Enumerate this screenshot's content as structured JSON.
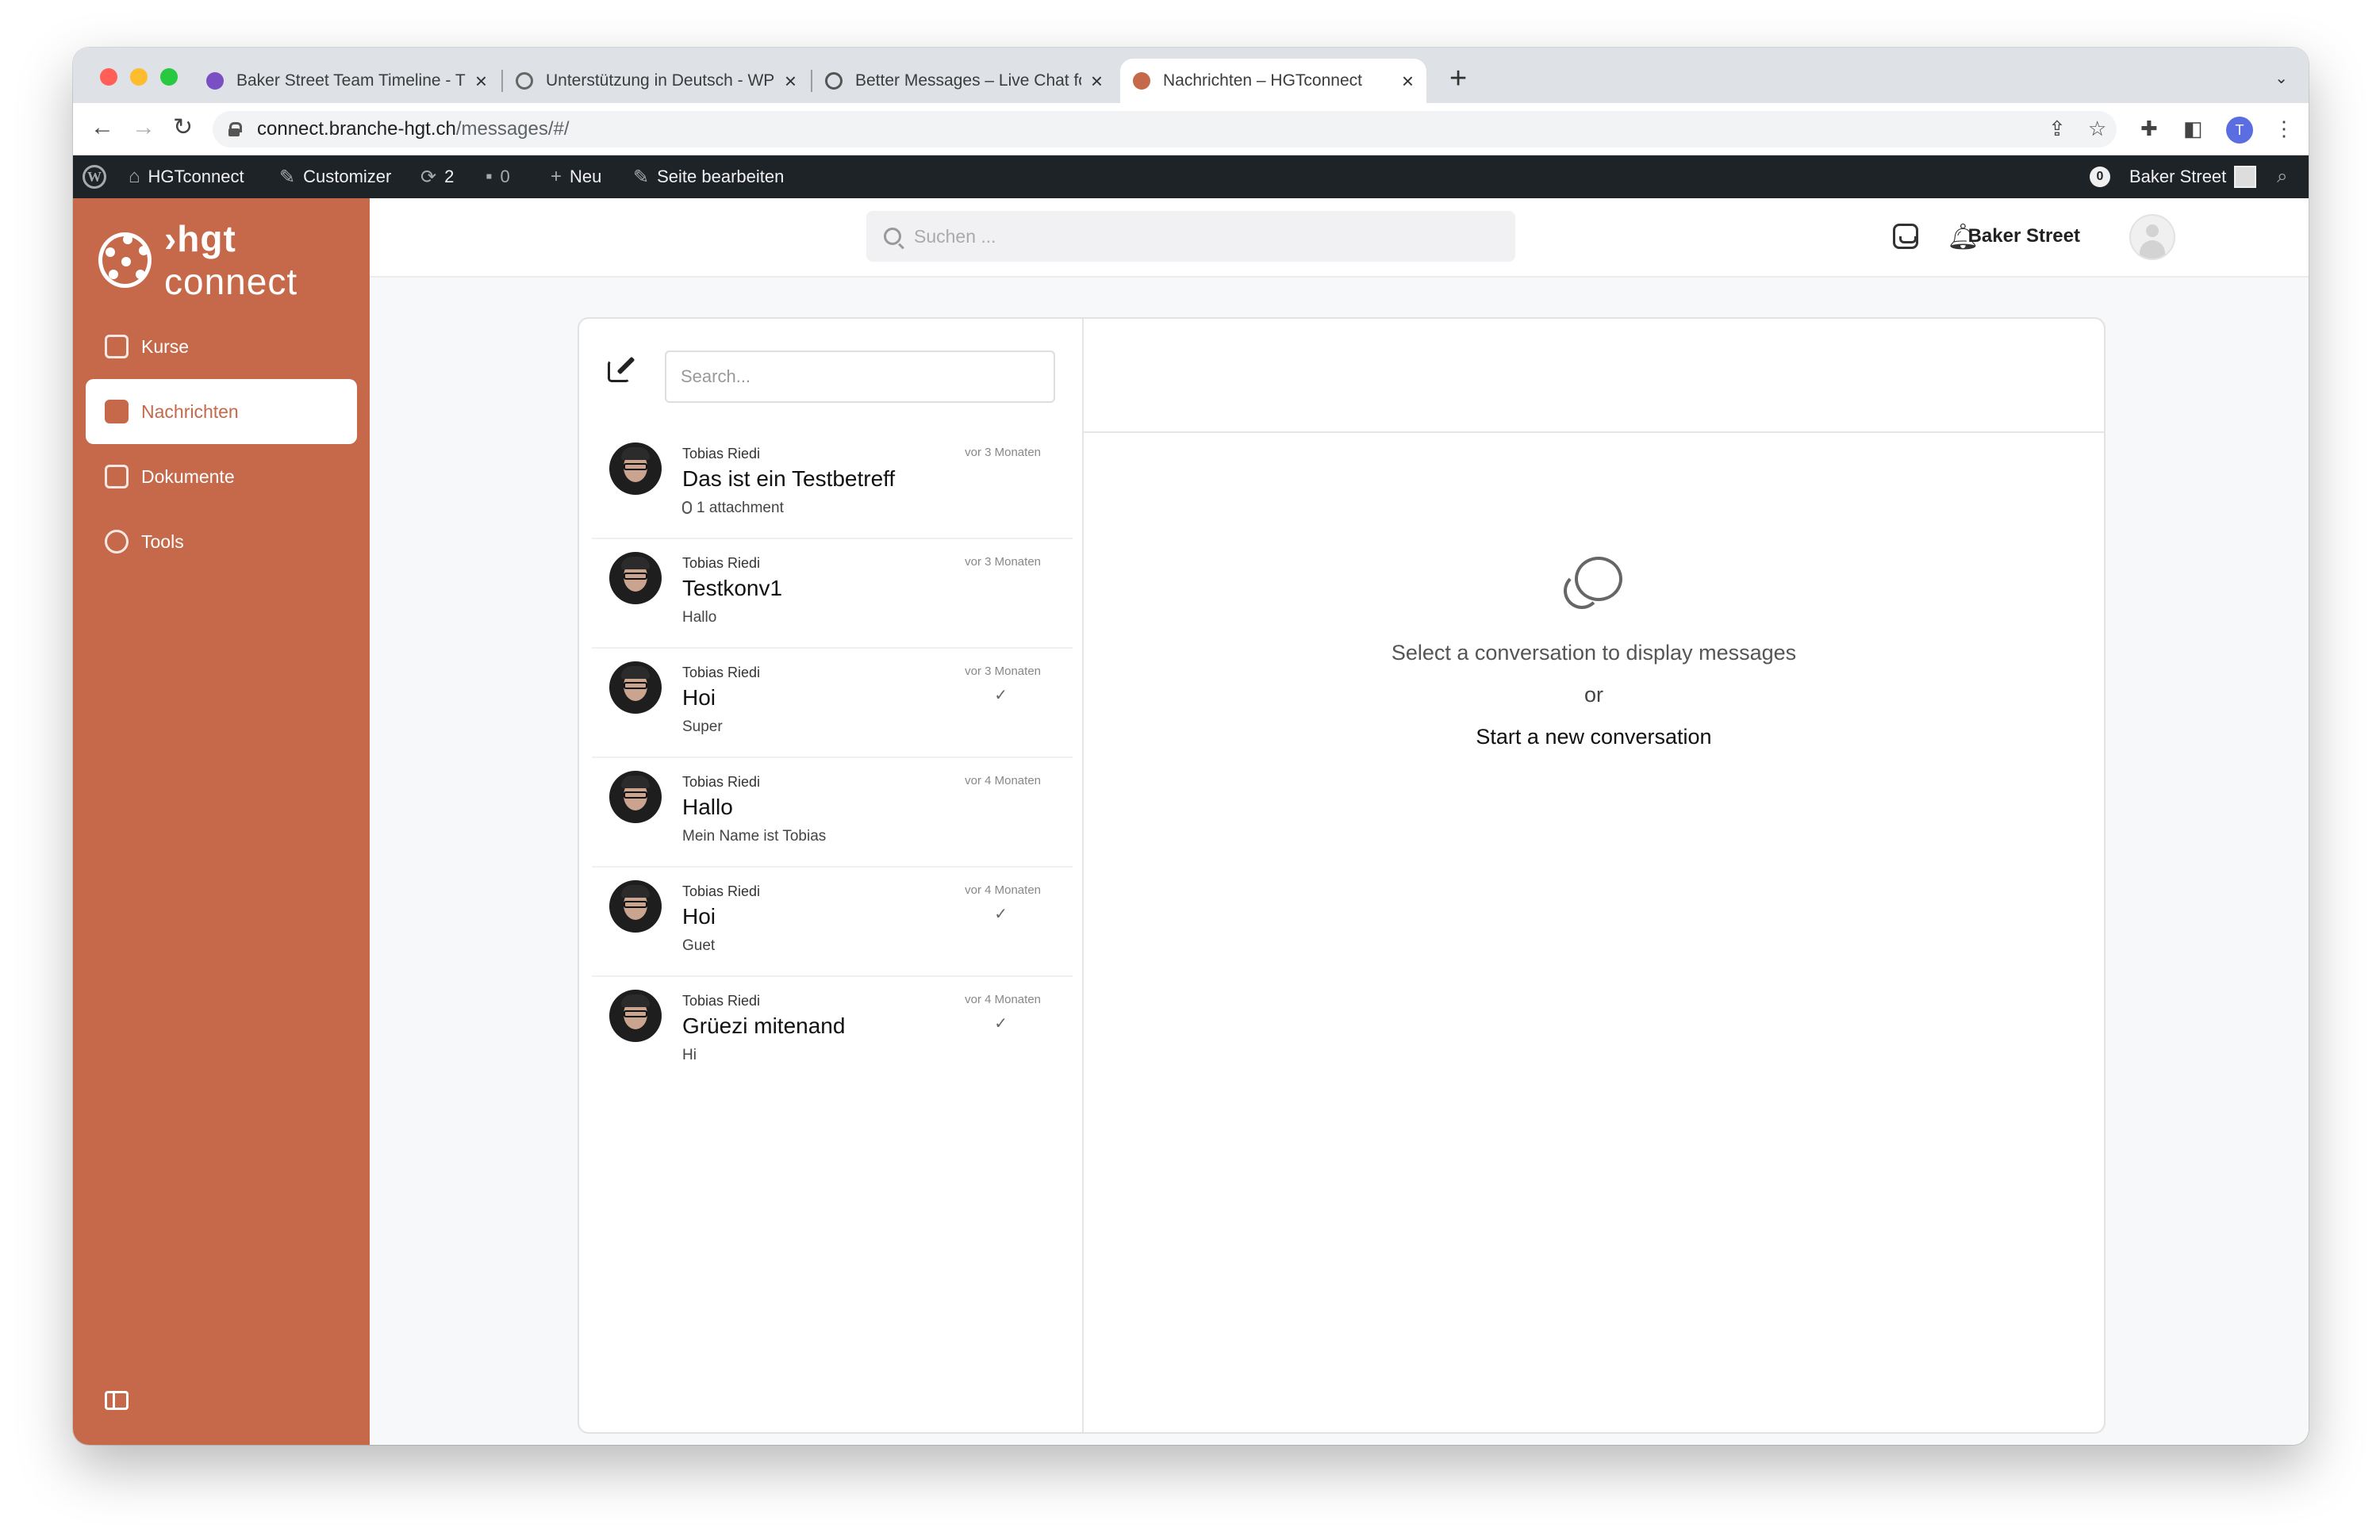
{
  "browser": {
    "tabs": [
      {
        "label": "Baker Street Team Timeline - T",
        "color": "#7a4fc4"
      },
      {
        "label": "Unterstützung in Deutsch - WP",
        "color": "#666666"
      },
      {
        "label": "Better Messages – Live Chat fo",
        "color": "#555555"
      },
      {
        "label": "Nachrichten – HGTconnect",
        "color": "#c5694a"
      }
    ],
    "url_host": "connect.branche-hgt.ch",
    "url_path": "/messages/#/",
    "profile_initial": "T"
  },
  "adminbar": {
    "site": "HGTconnect",
    "customizer": "Customizer",
    "updates": "2",
    "comments": "0",
    "new": "Neu",
    "edit": "Seite bearbeiten",
    "notifications": "0",
    "user": "Baker Street"
  },
  "sidebar": {
    "logo_bold": "›hgt",
    "logo_thin": "connect",
    "items": [
      {
        "label": "Kurse",
        "icon": "activity-icon"
      },
      {
        "label": "Nachrichten",
        "icon": "inbox-icon"
      },
      {
        "label": "Dokumente",
        "icon": "folder-icon"
      },
      {
        "label": "Tools",
        "icon": "lightbulb-icon"
      }
    ]
  },
  "topbar": {
    "search_placeholder": "Suchen ...",
    "user_name": "Baker Street"
  },
  "messages": {
    "search_placeholder": "Search...",
    "conversations": [
      {
        "sender": "Tobias Riedi",
        "time": "vor 3 Monaten",
        "subject": "Das ist ein Testbetreff",
        "preview": "1 attachment"
      },
      {
        "sender": "Tobias Riedi",
        "time": "vor 3 Monaten",
        "subject": "Testkonv1",
        "preview": "Hallo"
      },
      {
        "sender": "Tobias Riedi",
        "time": "vor 3 Monaten",
        "subject": "Hoi",
        "preview": "Super"
      },
      {
        "sender": "Tobias Riedi",
        "time": "vor 4 Monaten",
        "subject": "Hallo",
        "preview": "Mein Name ist Tobias"
      },
      {
        "sender": "Tobias Riedi",
        "time": "vor 4 Monaten",
        "subject": "Hoi",
        "preview": "Guet"
      },
      {
        "sender": "Tobias Riedi",
        "time": "vor 4 Monaten",
        "subject": "Grüezi mitenand",
        "preview": "Hi"
      }
    ],
    "empty_line1": "Select a conversation to display messages",
    "empty_or": "or",
    "empty_link": "Start a new conversation"
  },
  "colors": {
    "brand": "#c5694a",
    "adminbar": "#1d2327"
  }
}
